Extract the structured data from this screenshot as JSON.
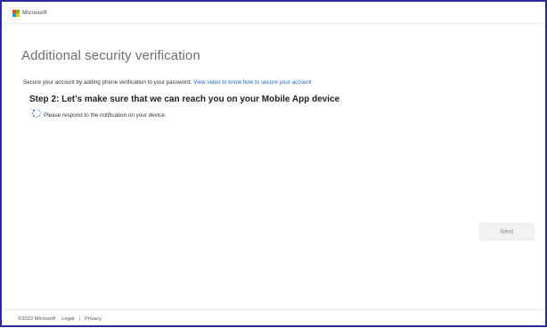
{
  "header": {
    "brand_name": "Microsoft",
    "logo_colors": [
      "#f25022",
      "#7fba00",
      "#00a4ef",
      "#ffb900"
    ]
  },
  "main": {
    "title": "Additional security verification",
    "description": "Secure your account by adding phone verification to your password.",
    "video_link": "View video to know how to secure your account",
    "step_heading": "Step 2: Let's make sure that we can reach you on your Mobile App device",
    "status_message": "Please respond to the notification on your device.",
    "next_label": "Next"
  },
  "footer": {
    "copyright": "©2022 Microsoft",
    "legal_label": "Legal",
    "separator": "|",
    "privacy_label": "Privacy"
  },
  "colors": {
    "frame_border": "#2b2a9a",
    "link": "#2266c4",
    "spinner": "#2b6bd6"
  }
}
